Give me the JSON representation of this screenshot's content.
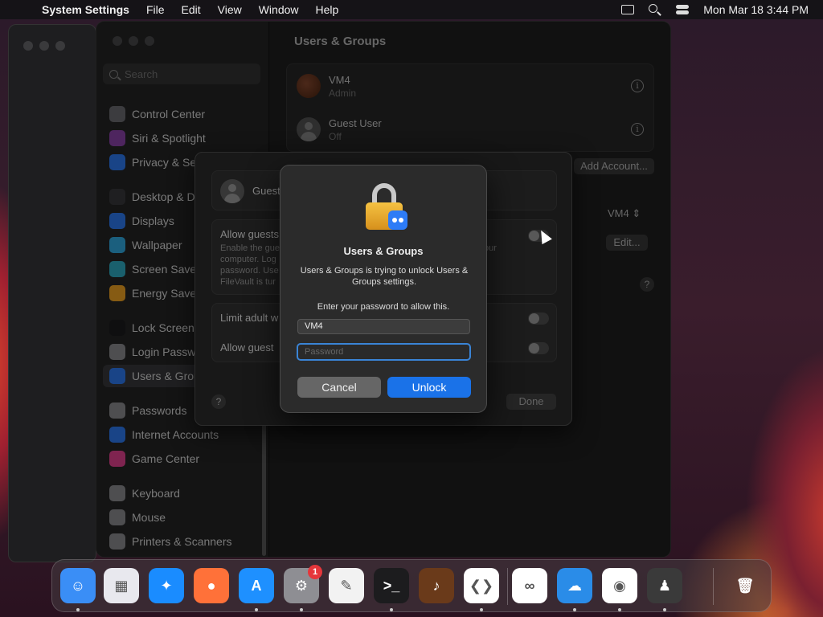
{
  "menubar": {
    "app_name": "System Settings",
    "items": [
      "File",
      "Edit",
      "View",
      "Window",
      "Help"
    ],
    "clock": "Mon Mar 18  3:44 PM"
  },
  "sidebar": {
    "search_placeholder": "Search",
    "items": [
      {
        "label": "Control Center",
        "icon": "control-center-icon",
        "color": "#6e6e73"
      },
      {
        "label": "Siri & Spotlight",
        "icon": "siri-icon",
        "color": "#8e44ad"
      },
      {
        "label": "Privacy & Sec",
        "icon": "hand-icon",
        "color": "#2e7cf6"
      },
      {
        "label": "Desktop & Do",
        "icon": "desktop-icon",
        "color": "#3a3a3c"
      },
      {
        "label": "Displays",
        "icon": "displays-icon",
        "color": "#2e7cf6"
      },
      {
        "label": "Wallpaper",
        "icon": "wallpaper-icon",
        "color": "#32ade6"
      },
      {
        "label": "Screen Saver",
        "icon": "screensaver-icon",
        "color": "#30b0c7"
      },
      {
        "label": "Energy Saver",
        "icon": "energy-icon",
        "color": "#f5a623"
      },
      {
        "label": "Lock Screen",
        "icon": "lock-icon",
        "color": "#1c1c1e"
      },
      {
        "label": "Login Passwo",
        "icon": "login-icon",
        "color": "#8e8e93"
      },
      {
        "label": "Users & Grou",
        "icon": "users-icon",
        "color": "#2e7cf6"
      },
      {
        "label": "Passwords",
        "icon": "key-icon",
        "color": "#8e8e93"
      },
      {
        "label": "Internet Accounts",
        "icon": "at-icon",
        "color": "#2e7cf6"
      },
      {
        "label": "Game Center",
        "icon": "game-center-icon",
        "color": "#e84393"
      },
      {
        "label": "Keyboard",
        "icon": "keyboard-icon",
        "color": "#8e8e93"
      },
      {
        "label": "Mouse",
        "icon": "mouse-icon",
        "color": "#8e8e93"
      },
      {
        "label": "Printers & Scanners",
        "icon": "printer-icon",
        "color": "#8e8e93"
      }
    ]
  },
  "content": {
    "title": "Users & Groups",
    "users": [
      {
        "name": "VM4",
        "role": "Admin"
      },
      {
        "name": "Guest User",
        "role": "Off"
      }
    ],
    "add_account": "Add Account...",
    "auto_login_value": "VM4",
    "edit": "Edit...",
    "help": "?"
  },
  "sheet": {
    "guest_label": "Guest",
    "allow_guests": "Allow guests",
    "allow_desc": "Enable the gue\ncomputer. Log\npassword. Use\nFileVault is tur",
    "desc_right": "our",
    "limit_adult": "Limit adult w",
    "allow_guest2": "Allow guest",
    "help": "?",
    "done": "Done"
  },
  "dialog": {
    "title": "Users & Groups",
    "message": "Users & Groups is trying to unlock Users & Groups settings.",
    "prompt": "Enter your password to allow this.",
    "username": "VM4",
    "password_placeholder": "Password",
    "cancel": "Cancel",
    "unlock": "Unlock"
  },
  "dock": {
    "apps": [
      {
        "name": "finder",
        "icon": "finder-icon",
        "glyph": "☺",
        "bg": "#3a8ef6"
      },
      {
        "name": "launchpad",
        "icon": "launchpad-icon",
        "glyph": "▦",
        "bg": "#e8e8ee"
      },
      {
        "name": "safari",
        "icon": "safari-icon",
        "glyph": "✦",
        "bg": "#1a8cff"
      },
      {
        "name": "firefox",
        "icon": "firefox-icon",
        "glyph": "●",
        "bg": "#ff7139"
      },
      {
        "name": "app-store",
        "icon": "app-store-icon",
        "glyph": "A",
        "bg": "#1e90ff"
      },
      {
        "name": "system-settings",
        "icon": "gear-icon",
        "glyph": "⚙",
        "bg": "#8e8e93",
        "badge": "1"
      },
      {
        "name": "textedit",
        "icon": "textedit-icon",
        "glyph": "✎",
        "bg": "#f2f2f2"
      },
      {
        "name": "terminal",
        "icon": "terminal-icon",
        "glyph": ">_",
        "bg": "#1c1c1e"
      },
      {
        "name": "garageband",
        "icon": "guitar-icon",
        "glyph": "♪",
        "bg": "#6a3a1a"
      },
      {
        "name": "vscode",
        "icon": "vscode-icon",
        "glyph": "❮❯",
        "bg": "#ffffff"
      },
      {
        "name": "visual-studio",
        "icon": "visual-studio-icon",
        "glyph": "∞",
        "bg": "#ffffff"
      },
      {
        "name": "weather",
        "icon": "cloud-icon",
        "glyph": "☁",
        "bg": "#2a8ce8"
      },
      {
        "name": "chrome",
        "icon": "chrome-icon",
        "glyph": "◉",
        "bg": "#ffffff"
      },
      {
        "name": "alfred",
        "icon": "butler-icon",
        "glyph": "♟",
        "bg": "#3a3a3a"
      },
      {
        "name": "trash",
        "icon": "trash-icon",
        "glyph": "🗑",
        "bg": "transparent"
      }
    ]
  }
}
